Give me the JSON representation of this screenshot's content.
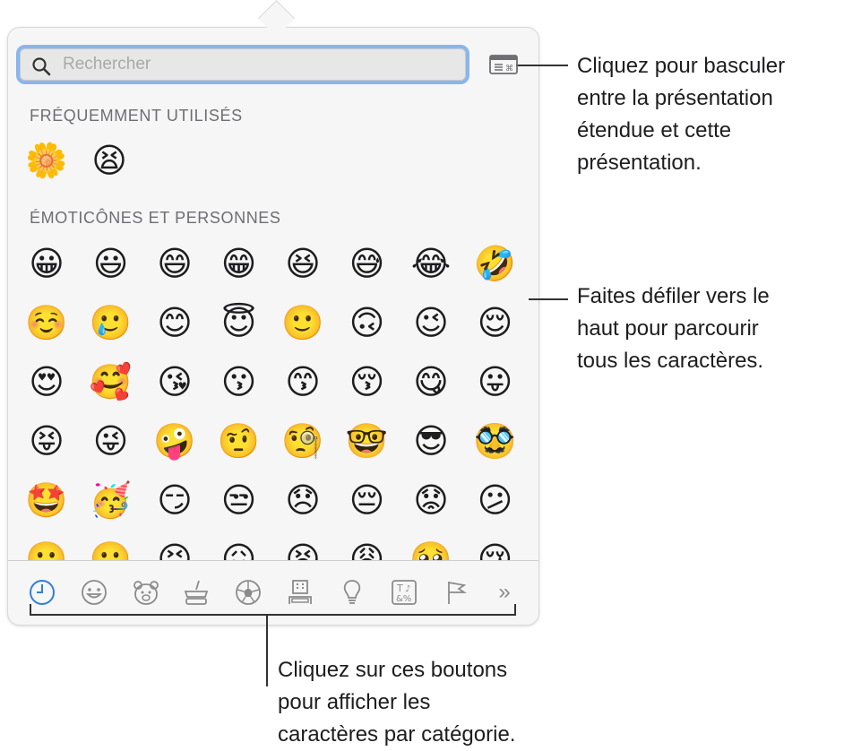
{
  "search": {
    "placeholder": "Rechercher"
  },
  "sections": {
    "frequent_title": "FRÉQUEMMENT UTILISÉS",
    "frequent": [
      "🌼",
      "😫"
    ],
    "people_title": "ÉMOTICÔNES ET PERSONNES",
    "people": [
      "😀",
      "😃",
      "😄",
      "😁",
      "😆",
      "😅",
      "😂",
      "🤣",
      "☺️",
      "🥲",
      "😊",
      "😇",
      "🙂",
      "🙃",
      "😉",
      "😌",
      "😍",
      "🥰",
      "😘",
      "😗",
      "😙",
      "😚",
      "😋",
      "😛",
      "😝",
      "😜",
      "🤪",
      "🤨",
      "🧐",
      "🤓",
      "😎",
      "🥸",
      "🤩",
      "🥳",
      "😏",
      "😒",
      "😞",
      "😔",
      "😟",
      "😕",
      "🙁",
      "☹️",
      "😣",
      "😖",
      "😫",
      "😩",
      "🥺",
      "😢"
    ]
  },
  "tabs": [
    "recent-icon",
    "smiley-icon",
    "animal-icon",
    "food-icon",
    "ball-icon",
    "building-icon",
    "lightbulb-icon",
    "symbols-icon",
    "flag-icon",
    "more-icon"
  ],
  "tab_more_label": "»",
  "callouts": {
    "toggle": "Cliquez pour basculer\nentre la présentation\nétendue et cette\nprésentation.",
    "scroll": "Faites défiler vers le\nhaut pour parcourir\ntous les caractères.",
    "categories": "Cliquez sur ces boutons\npour afficher les\ncaractères par catégorie."
  },
  "colors": {
    "accent": "#2f7fdd",
    "focus_ring": "#88b6ef",
    "icon_gray": "#8b8b8b"
  }
}
